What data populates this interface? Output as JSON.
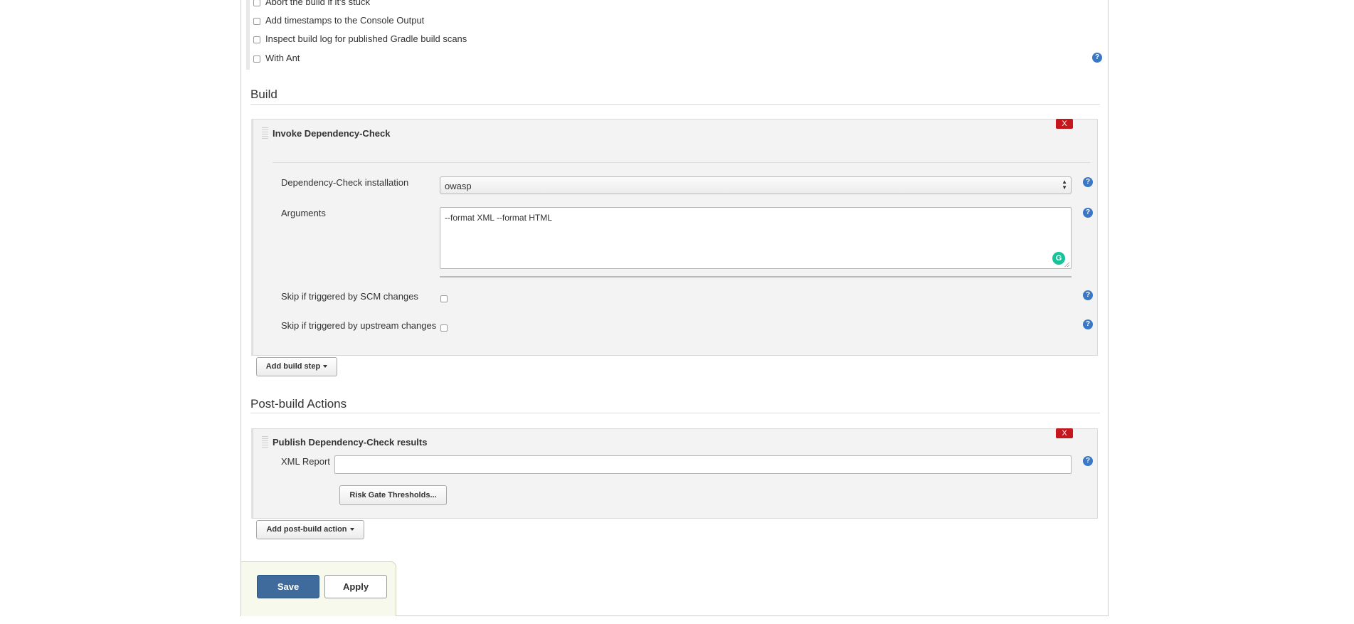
{
  "options": {
    "items": [
      {
        "label": "Abort the build if it's stuck",
        "checked": false
      },
      {
        "label": "Add timestamps to the Console Output",
        "checked": false
      },
      {
        "label": "Inspect build log for published Gradle build scans",
        "checked": false
      },
      {
        "label": "With Ant",
        "checked": false
      }
    ],
    "help_glyph": "?"
  },
  "build": {
    "section_title": "Build",
    "step": {
      "title": "Invoke Dependency-Check",
      "remove_label": "X",
      "installation_label": "Dependency-Check installation",
      "installation_value": "owasp",
      "arguments_label": "Arguments",
      "arguments_value": "--format XML --format HTML",
      "skip_scm_label": "Skip if triggered by SCM changes",
      "skip_upstream_label": "Skip if triggered by upstream changes"
    },
    "add_step_label": "Add build step"
  },
  "post_build": {
    "section_title": "Post-build Actions",
    "action": {
      "title": "Publish Dependency-Check results",
      "remove_label": "X",
      "xml_report_label": "XML Report",
      "xml_report_value": "",
      "risk_gate_label": "Risk Gate Thresholds..."
    },
    "add_action_label": "Add post-build action"
  },
  "footer": {
    "save_label": "Save",
    "apply_label": "Apply"
  },
  "icons": {
    "help": "help-icon",
    "remove": "close-icon",
    "grammarly": "grammarly-icon",
    "dropdown": "chevron-down-icon"
  },
  "colors": {
    "primary_button": "#3e6b9b",
    "remove_button": "#c4161c",
    "help_icon": "#3a78c6",
    "panel_background": "#f3f3f3",
    "footer_background": "#f8f9ed"
  }
}
